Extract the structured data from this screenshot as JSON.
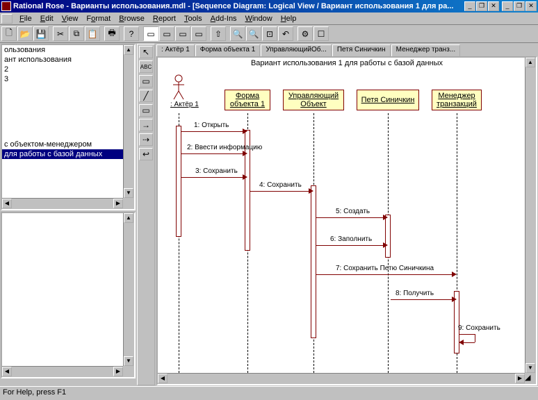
{
  "title": "Rational Rose - Варианты использования.mdl - [Sequence Diagram: Logical View / Вариант использования 1 для ра...",
  "menu": {
    "file": "File",
    "edit": "Edit",
    "view": "View",
    "format": "Format",
    "browse": "Browse",
    "report": "Report",
    "tools": "Tools",
    "addins": "Add-Ins",
    "window": "Window",
    "help": "Help"
  },
  "tree": {
    "i0": "ользования",
    "i1": "ант использования",
    "i2": "2",
    "i3": "3",
    "i4": "с объектом-менеджером",
    "i5": "для работы с базой данных"
  },
  "tabs": {
    "t0": ": Актёр 1",
    "t1": "Форма объекта 1",
    "t2": "УправляющийОб...",
    "t3": "Петя Синичкин",
    "t4": "Менеджер транз..."
  },
  "diagram": {
    "title": "Вариант использования 1 для работы с базой данных",
    "actor": ": Актёр 1",
    "obj1a": "Форма",
    "obj1b": "объекта 1",
    "obj2a": "Управляющий",
    "obj2b": "Объект",
    "obj3": "Петя Синичкин",
    "obj4a": "Менеджер",
    "obj4b": "транзакций",
    "m1": "1: Открыть",
    "m2": "2: Ввести информацию",
    "m3": "3: Сохранить",
    "m4": "4: Сохранить",
    "m5": "5: Создать",
    "m6": "6: Заполнить",
    "m7": "7: Сохранить Петю Синичкина",
    "m8": "8: Получить",
    "m9": "9: Сохранить"
  },
  "status": "For Help, press F1"
}
